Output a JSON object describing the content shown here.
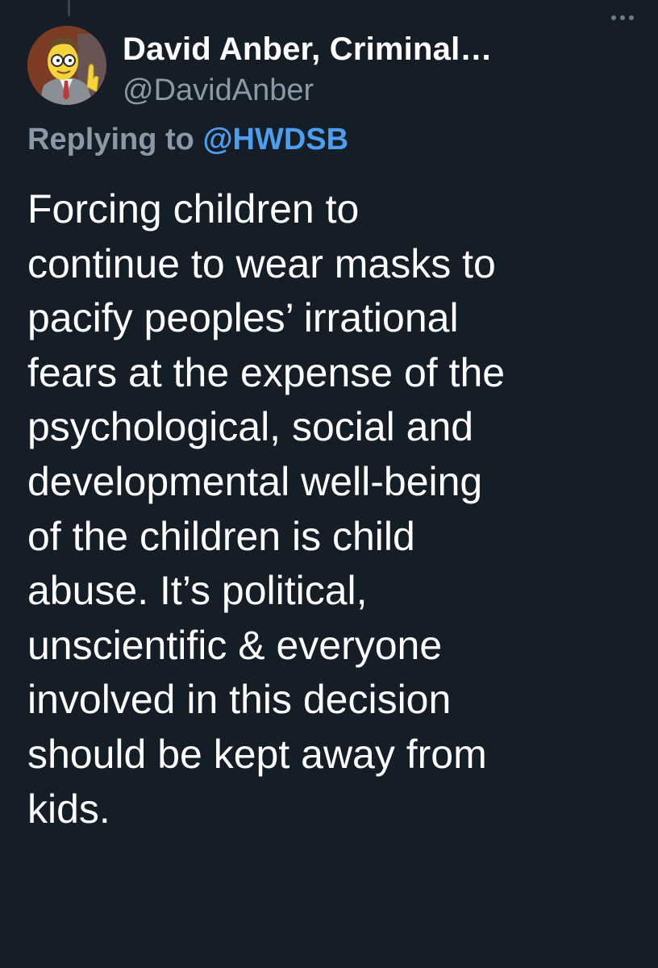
{
  "tweet": {
    "author": {
      "display_name": "David Anber, Criminal…",
      "handle": "@DavidAnber",
      "avatar_icon": "cartoon-man-with-glasses-avatar"
    },
    "more_icon": "more-horizontal-icon",
    "reply": {
      "prefix": "Replying to",
      "handle": "@HWDSB"
    },
    "text": "Forcing children to\ncontinue to wear masks to\npacify peoples’ irrational\nfears at the expense of the\npsychological, social and\ndevelopmental well-being\nof the children is child\nabuse. It’s political,\nunscientific & everyone\ninvolved in this decision\nshould be kept away from\nkids."
  },
  "colors": {
    "background": "#151d27",
    "text_primary": "#ffffff",
    "text_secondary": "#8b98a5",
    "link": "#4e9ef0"
  }
}
